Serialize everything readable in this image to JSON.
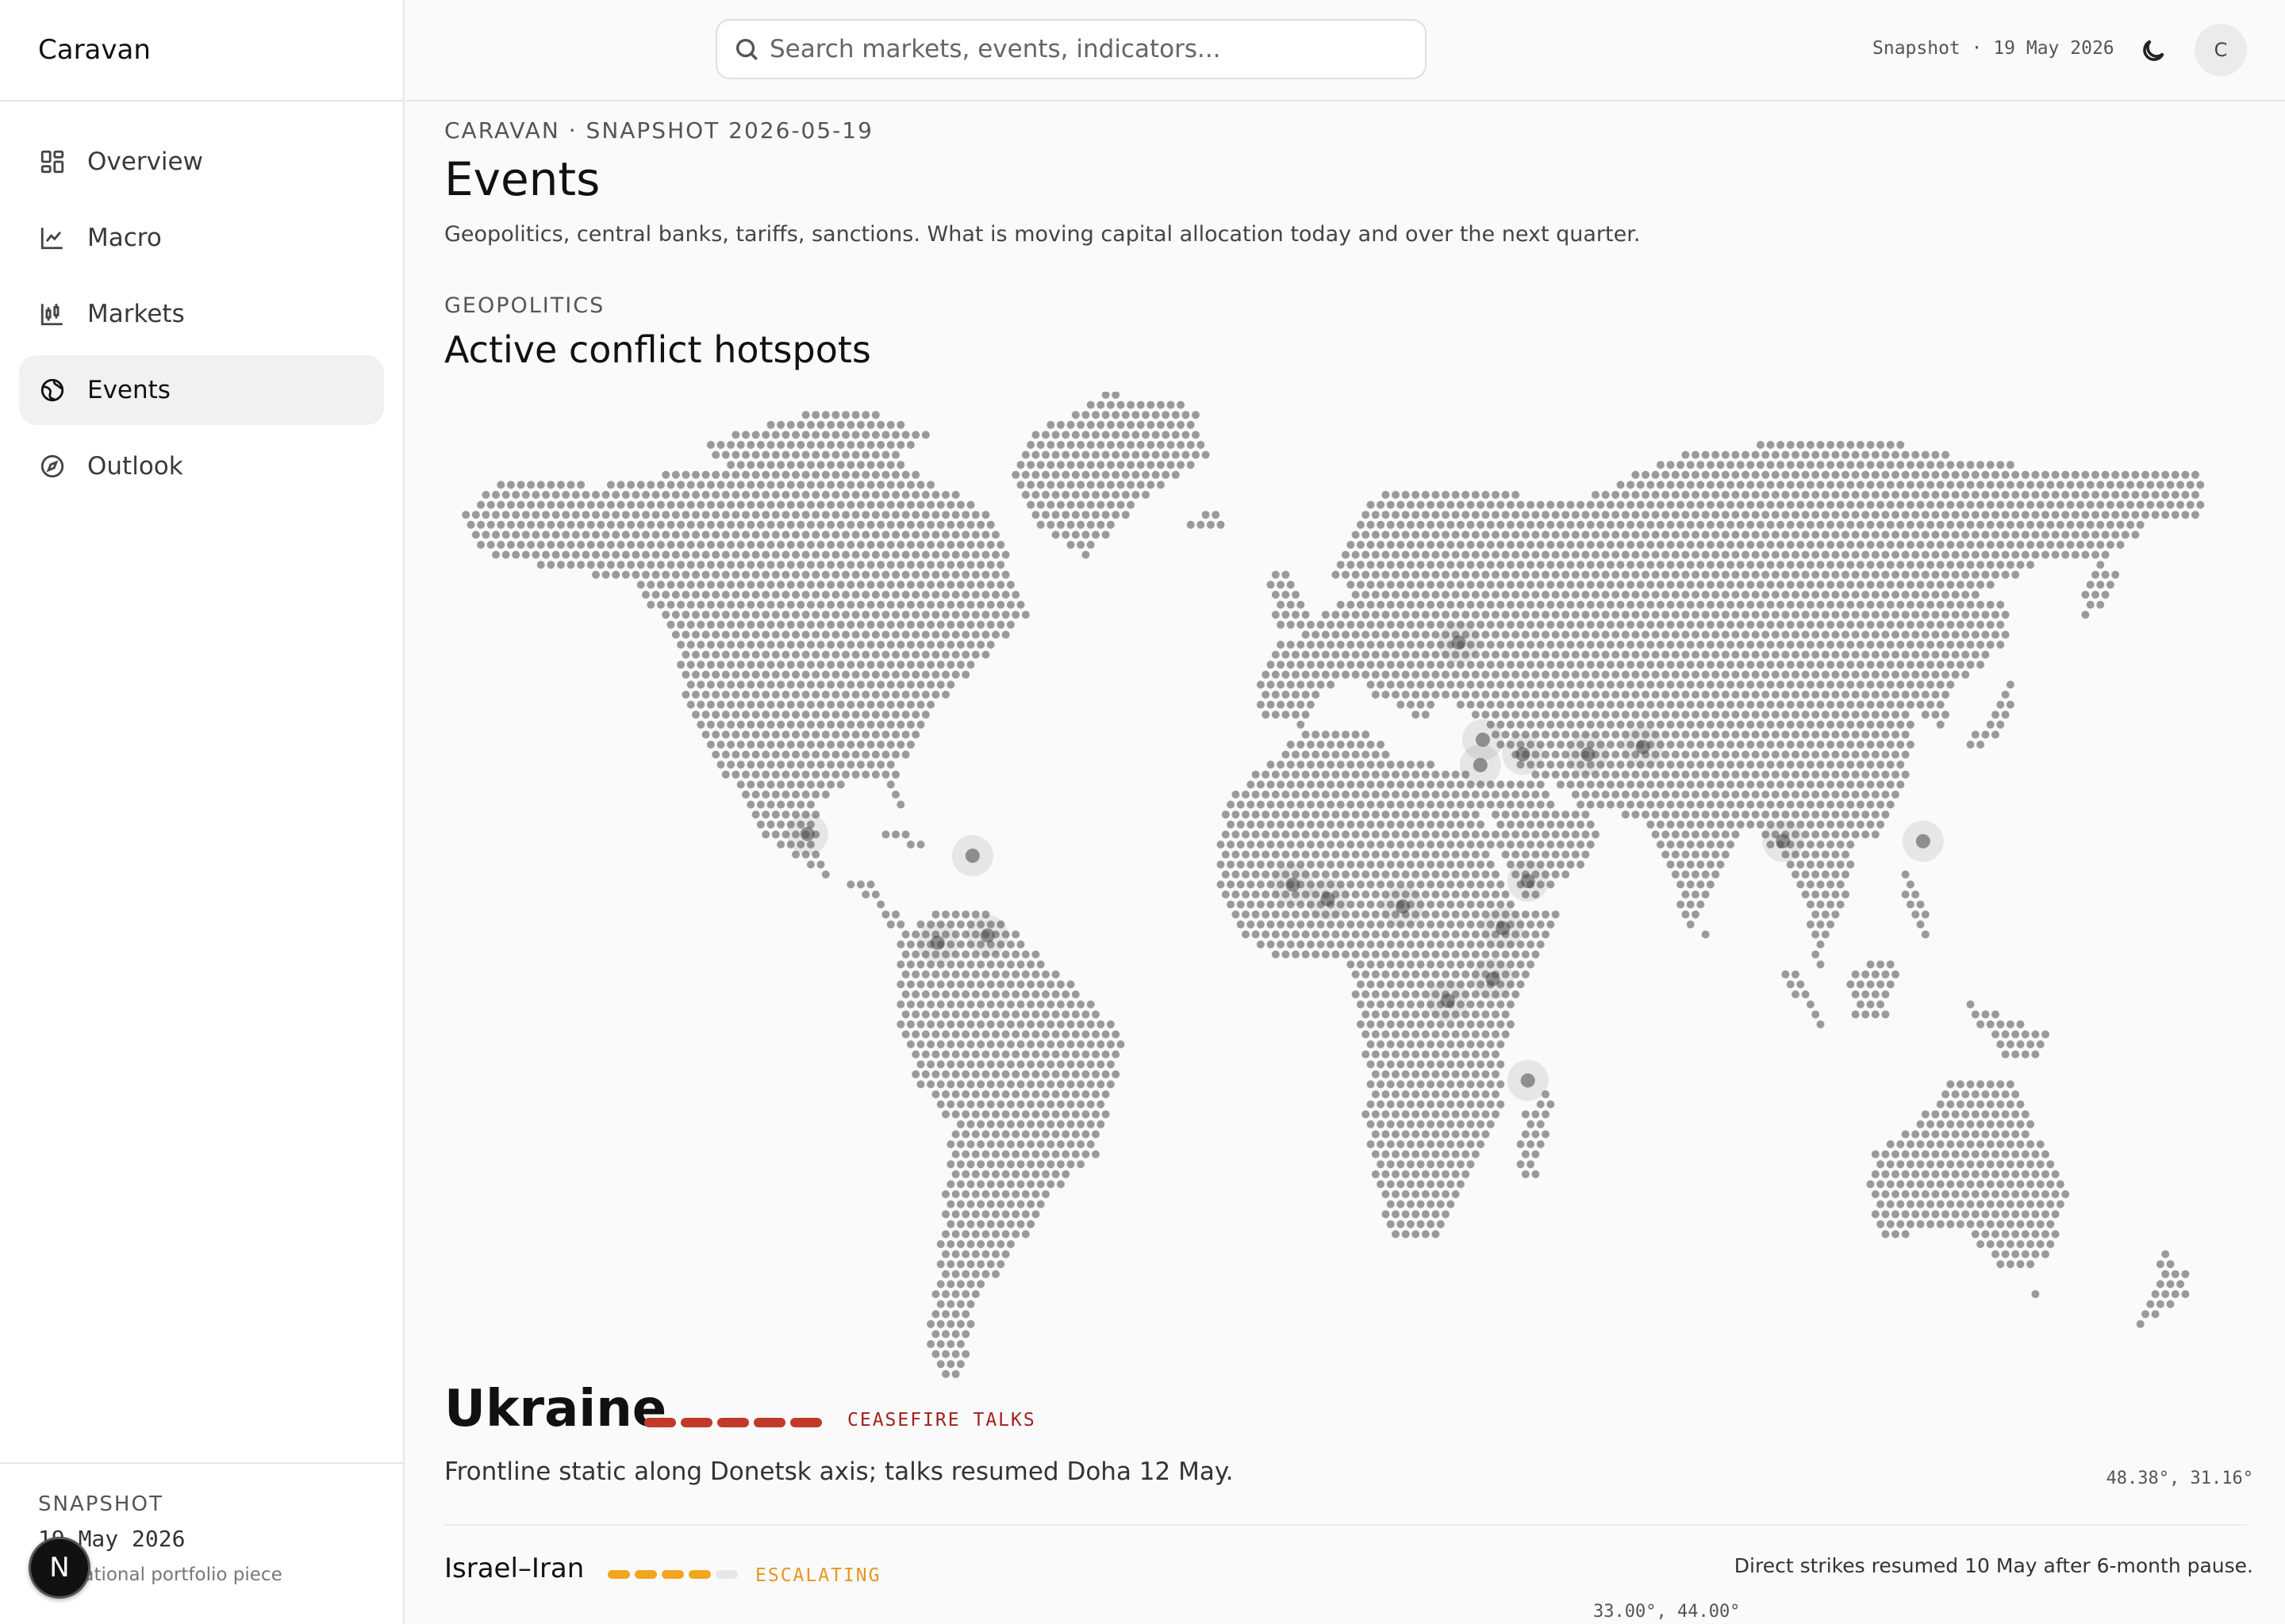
{
  "app": {
    "name": "Caravan"
  },
  "sidebar": {
    "items": [
      {
        "label": "Overview",
        "icon": "dashboard-grid-icon"
      },
      {
        "label": "Macro",
        "icon": "line-chart-icon"
      },
      {
        "label": "Markets",
        "icon": "candlestick-chart-icon"
      },
      {
        "label": "Events",
        "icon": "globe-icon",
        "active": true
      },
      {
        "label": "Outlook",
        "icon": "compass-icon"
      }
    ],
    "footer": {
      "label": "SNAPSHOT",
      "date": "19 May 2026",
      "note": "Educational portfolio piece"
    },
    "badge": "N"
  },
  "header": {
    "search_placeholder": "Search markets, events, indicators...",
    "snapshot": "Snapshot · 19 May 2026",
    "avatar": "C"
  },
  "main": {
    "eyebrow": "CARAVAN · SNAPSHOT 2026-05-19",
    "title": "Events",
    "subtitle": "Geopolitics, central banks, tariffs, sanctions. What is moving capital allocation today and over the next quarter.",
    "section": {
      "eyebrow": "GEOPOLITICS",
      "title": "Active conflict hotspots"
    },
    "hotspots": [
      {
        "name": "Ukraine",
        "status": "CEASEFIRE TALKS",
        "status_color": "#a31f1f",
        "bar_color": "#c0392b",
        "severity": 5,
        "description": "Frontline static along Donetsk axis; talks resumed Doha 12 May.",
        "coords": "48.38°, 31.16°"
      },
      {
        "name": "Israel–Iran",
        "status": "ESCALATING",
        "status_color": "#e6971e",
        "bar_color": "#f2a51f",
        "severity": 4,
        "description": "Direct strikes resumed 10 May after 6-month pause.",
        "coords": "33.00°, 44.00°"
      }
    ]
  },
  "colors": {
    "accent_red": "#c0392b",
    "accent_amber": "#f2a51f",
    "land_dot": "#9a9a9a"
  }
}
